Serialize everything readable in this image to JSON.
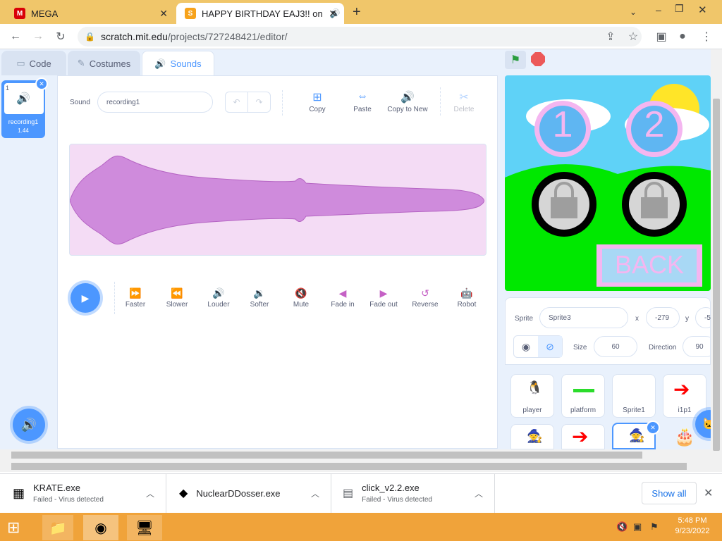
{
  "browser": {
    "tabs": [
      {
        "title": "MEGA",
        "favicon": "mega-icon"
      },
      {
        "title": "HAPPY BIRTHDAY EAJ3!! on",
        "favicon": "scratch-icon"
      }
    ],
    "url_host": "scratch.mit.edu",
    "url_path": "/projects/727248421/editor/"
  },
  "editor": {
    "tabs": [
      "Code",
      "Costumes",
      "Sounds"
    ],
    "sound_item": {
      "index": "1",
      "name": "recording1",
      "duration": "1.44"
    },
    "sound_label": "Sound",
    "sound_name": "recording1",
    "actions": [
      "Copy",
      "Paste",
      "Copy to New",
      "Delete"
    ],
    "effects": [
      "Faster",
      "Slower",
      "Louder",
      "Softer",
      "Mute",
      "Fade in",
      "Fade out",
      "Reverse",
      "Robot"
    ],
    "waveform_color": "#cf8bdc"
  },
  "stage": {
    "buttons": [
      "1",
      "2"
    ],
    "back_label": "BACK"
  },
  "sprite_info": {
    "sprite_label": "Sprite",
    "sprite_name": "Sprite3",
    "x_label": "x",
    "x_value": "-279",
    "y_label": "y",
    "y_value": "-5",
    "size_label": "Size",
    "size_value": "60",
    "direction_label": "Direction",
    "direction_value": "90"
  },
  "sprites": [
    "player",
    "platform",
    "Sprite1",
    "i1p1"
  ],
  "downloads": [
    {
      "name": "KRATE.exe",
      "status": "Failed - Virus detected"
    },
    {
      "name": "NuclearDDosser.exe",
      "status": ""
    },
    {
      "name": "click_v2.2.exe",
      "status": "Failed - Virus detected"
    }
  ],
  "downloads_show_all": "Show all",
  "clock": {
    "time": "5:48 PM",
    "date": "9/23/2022"
  }
}
